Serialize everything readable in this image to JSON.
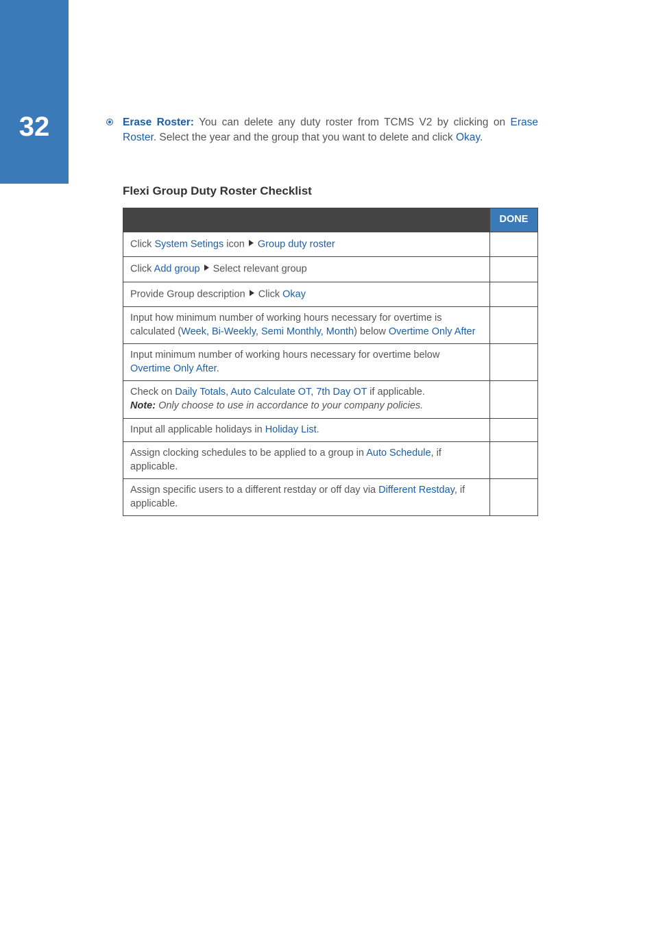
{
  "pageNumber": "32",
  "para": {
    "lead": "Erase Roster:",
    "part1": " You can delete any duty roster from TCMS V2 by clicking on ",
    "link1": "Erase Roster",
    "part2": ". Select the year and the group that you want to delete and click ",
    "link2": "Okay",
    "part3": "."
  },
  "sectionHeading": "Flexi Group Duty Roster Checklist",
  "doneHeader": "DONE",
  "rows": {
    "r1": {
      "a": "Click ",
      "b": "System Setings",
      "c": " icon ",
      "d": "Group duty roster"
    },
    "r2": {
      "a": "Click ",
      "b": "Add group",
      "c": " Select relevant group"
    },
    "r3": {
      "a": "Provide Group description ",
      "b": " Click ",
      "c": "Okay"
    },
    "r4": {
      "a": "Input how minimum number of working hours necessary for overtime is calculated (",
      "b": "Week, Bi-Weekly, Semi Monthly, Month",
      "c": ") below ",
      "d": "Overtime Only After"
    },
    "r5": {
      "a": "Input minimum number of working hours necessary for overtime below ",
      "b": "Overtime Only After",
      "c": "."
    },
    "r6": {
      "a": "Check on ",
      "b": "Daily Totals, Auto Calculate OT, 7th Day OT",
      "c": " if applicable.",
      "noteLabel": "Note:",
      "noteText": " Only choose to use in accordance to your company policies."
    },
    "r7": {
      "a": "Input all applicable holidays in ",
      "b": "Holiday List",
      "c": "."
    },
    "r8": {
      "a": "Assign clocking schedules to be applied to a group in ",
      "b": "Auto Schedule",
      "c": ", if applicable."
    },
    "r9": {
      "a": "Assign specific users to a different restday or off day via ",
      "b": "Different Restday",
      "c": ", if applicable."
    }
  }
}
